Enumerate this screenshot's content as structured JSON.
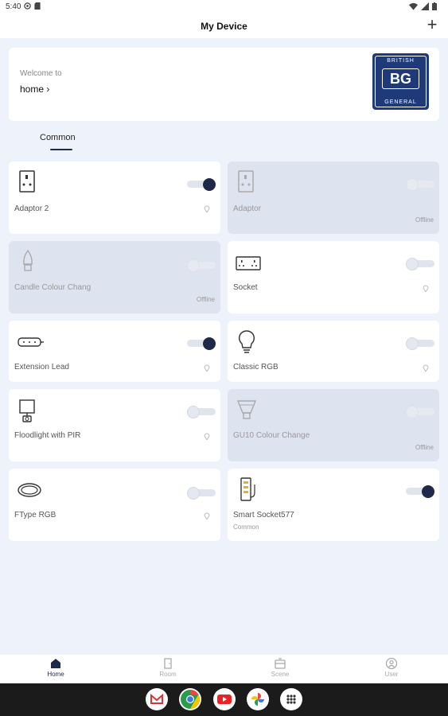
{
  "status_bar": {
    "time": "5:40"
  },
  "app_bar": {
    "title": "My Device",
    "add_label": "+"
  },
  "welcome": {
    "line1": "Welcome to",
    "home_label": "home ›",
    "logo_top": "BRITISH",
    "logo_mid": "BG",
    "logo_bottom": "GENERAL"
  },
  "tabs": [
    {
      "label": "Common"
    }
  ],
  "devices": [
    {
      "name": "Adaptor 2",
      "toggle": "on",
      "online": true
    },
    {
      "name": "Adaptor",
      "toggle": "off",
      "online": false,
      "status": "Offline"
    },
    {
      "name": "Candle Colour Chang",
      "toggle": "off",
      "online": false,
      "status": "Offline"
    },
    {
      "name": "Socket",
      "toggle": "off",
      "online": true
    },
    {
      "name": "Extension Lead",
      "toggle": "on",
      "online": true
    },
    {
      "name": "Classic RGB",
      "toggle": "off",
      "online": true
    },
    {
      "name": "Floodlight with PIR",
      "toggle": "off",
      "online": true
    },
    {
      "name": "GU10 Colour Change",
      "toggle": "off",
      "online": false,
      "status": "Offline"
    },
    {
      "name": "FType RGB",
      "toggle": "off",
      "online": true
    },
    {
      "name": "Smart Socket577",
      "toggle": "on",
      "online": true,
      "sub": "Common"
    }
  ],
  "bottom_nav": [
    {
      "label": "Home",
      "active": true
    },
    {
      "label": "Room"
    },
    {
      "label": "Scene"
    },
    {
      "label": "User"
    }
  ],
  "colors": {
    "accent": "#1f2a4a",
    "brand": "#1f3a78",
    "background": "#eef2fa",
    "offline_card": "#dde3ef"
  },
  "taskbar_apps": [
    "gmail-icon",
    "chrome-icon",
    "youtube-icon",
    "photos-icon",
    "app-drawer-icon"
  ]
}
